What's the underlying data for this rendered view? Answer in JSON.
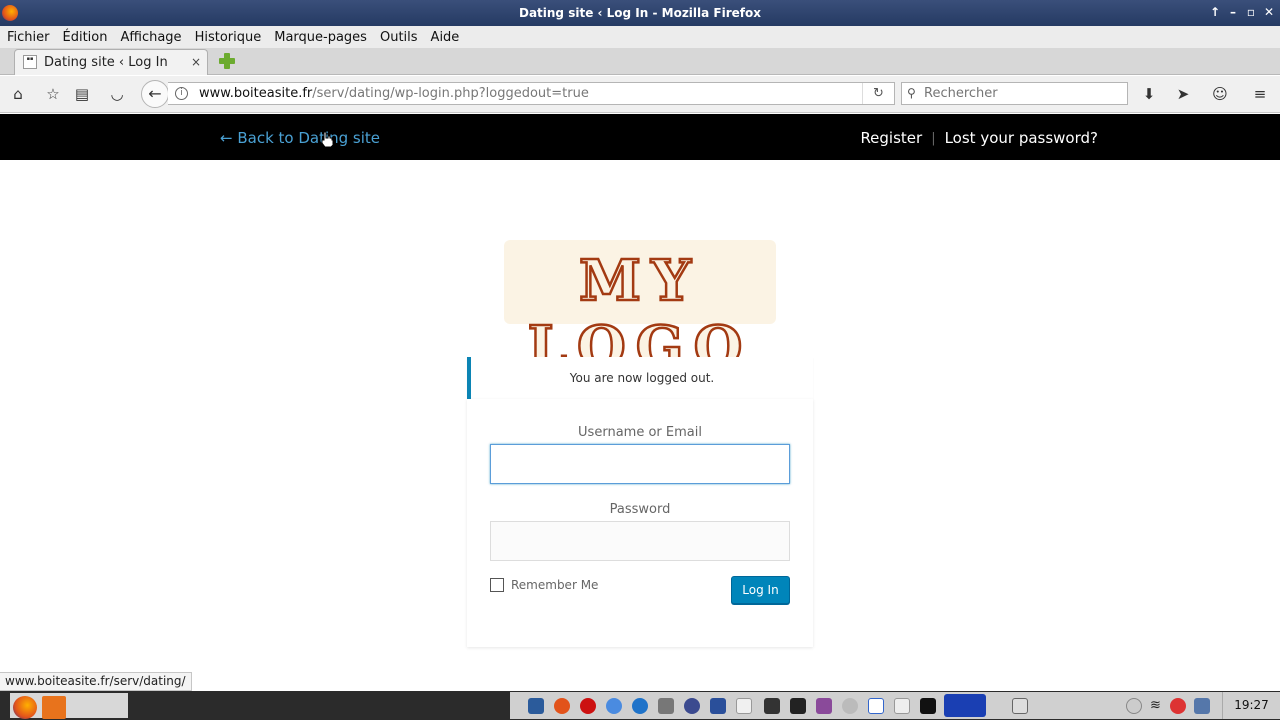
{
  "window": {
    "title": "Dating site ‹ Log In - Mozilla Firefox"
  },
  "menu": [
    {
      "label": "Fichier"
    },
    {
      "label": "Édition"
    },
    {
      "label": "Affichage"
    },
    {
      "label": "Historique"
    },
    {
      "label": "Marque-pages"
    },
    {
      "label": "Outils"
    },
    {
      "label": "Aide"
    }
  ],
  "tab": {
    "title": "Dating site ‹ Log In",
    "close": "×"
  },
  "navbar": {
    "url_domain": "www.boiteasite.fr",
    "url_path": "/serv/dating/wp-login.php?loggedout=true",
    "search_placeholder": "Rechercher"
  },
  "site_header": {
    "back_link": "← Back to Dating site",
    "register": "Register",
    "separator": "|",
    "lost_password": "Lost your password?"
  },
  "logo": {
    "text": "MY LOGO"
  },
  "message": {
    "text": "You are now logged out."
  },
  "form": {
    "username_label": "Username or Email",
    "username_value": "",
    "password_label": "Password",
    "password_value": "",
    "remember_label": "Remember Me",
    "remember_checked": false,
    "submit_label": "Log In"
  },
  "statusbar": {
    "text": "www.boiteasite.fr/serv/dating/"
  },
  "taskbar": {
    "clock": "19:27"
  },
  "colors": {
    "accent": "#0085ba",
    "link": "#4aa1d4",
    "notice_border": "#0b84b4",
    "header_bg": "#000000"
  }
}
